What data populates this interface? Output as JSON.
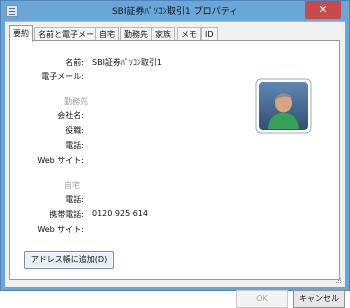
{
  "window": {
    "title": "SBI証券ﾊﾟｿｺﾝ取引1 プロパティ",
    "close_glyph": "✕"
  },
  "tabs": [
    {
      "label": "要約",
      "active": true
    },
    {
      "label": "名前と電子メール",
      "active": false
    },
    {
      "label": "自宅",
      "active": false
    },
    {
      "label": "勤務先",
      "active": false
    },
    {
      "label": "家族",
      "active": false
    },
    {
      "label": "メモ",
      "active": false
    },
    {
      "label": "ID",
      "active": false
    }
  ],
  "summary": {
    "name_label": "名前:",
    "name_value": "SBI証券ﾊﾟｿｺﾝ取引1",
    "email_label": "電子メール:",
    "email_value": "",
    "business": {
      "section_label": "勤務先",
      "company_label": "会社名:",
      "title_label": "役職:",
      "phone_label": "電話:",
      "website_label": "Web サイト:"
    },
    "home": {
      "section_label": "自宅",
      "phone_label": "電話:",
      "mobile_label": "携帯電話:",
      "mobile_value": "0120 925 614",
      "website_label": "Web サイト:"
    }
  },
  "buttons": {
    "add_to_address_book": "アドレス帳に追加(D)",
    "ok": "OK",
    "cancel": "キャンセル"
  },
  "colors": {
    "titlebar": "#6aa6d8",
    "close": "#c74b4b",
    "section_text": "#a0a0a0"
  }
}
